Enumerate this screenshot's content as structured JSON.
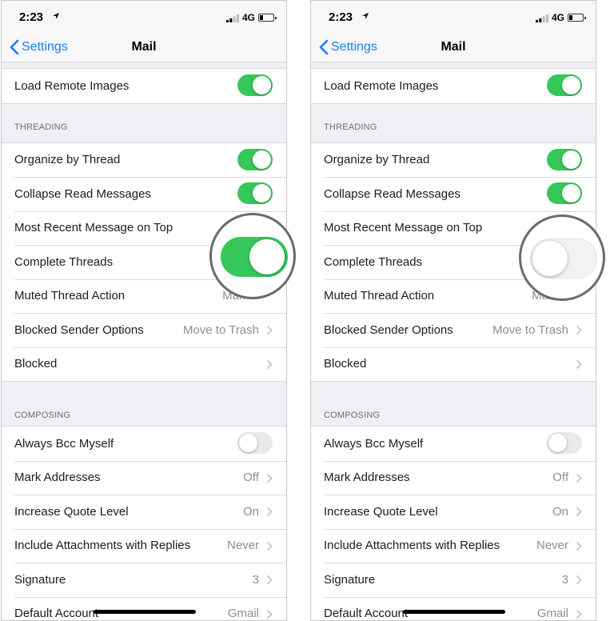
{
  "status_bar": {
    "time": "2:23",
    "network": "4G"
  },
  "nav": {
    "back_label": "Settings",
    "title": "Mail"
  },
  "top_row": {
    "label": "Load Remote Images",
    "toggle": true
  },
  "threading": {
    "header": "THREADING",
    "organize_by_thread": {
      "label": "Organize by Thread",
      "toggle": true
    },
    "collapse_read_messages": {
      "label": "Collapse Read Messages",
      "toggle": true
    },
    "most_recent_on_top": {
      "label": "Most Recent Message on Top"
    },
    "complete_threads": {
      "label": "Complete Threads"
    },
    "muted_thread_action": {
      "label": "Muted Thread Action",
      "value": "Mark a"
    },
    "blocked_sender_options": {
      "label": "Blocked Sender Options",
      "value": "Move to Trash"
    },
    "blocked": {
      "label": "Blocked"
    }
  },
  "composing": {
    "header": "COMPOSING",
    "always_bcc_myself": {
      "label": "Always Bcc Myself",
      "toggle": false
    },
    "mark_addresses": {
      "label": "Mark Addresses",
      "value": "Off"
    },
    "increase_quote_level": {
      "label": "Increase Quote Level",
      "value": "On"
    },
    "include_attachments": {
      "label": "Include Attachments with Replies",
      "value": "Never"
    },
    "signature": {
      "label": "Signature",
      "value": "3"
    },
    "default_account": {
      "label": "Default Account",
      "value": "Gmail"
    }
  },
  "magnified_toggle": {
    "left_state": "on",
    "right_state": "off"
  },
  "colors": {
    "toggle_on": "#35c759",
    "toggle_off": "#e9e9eb",
    "link_blue": "#147efb",
    "background": "#efeff4"
  }
}
